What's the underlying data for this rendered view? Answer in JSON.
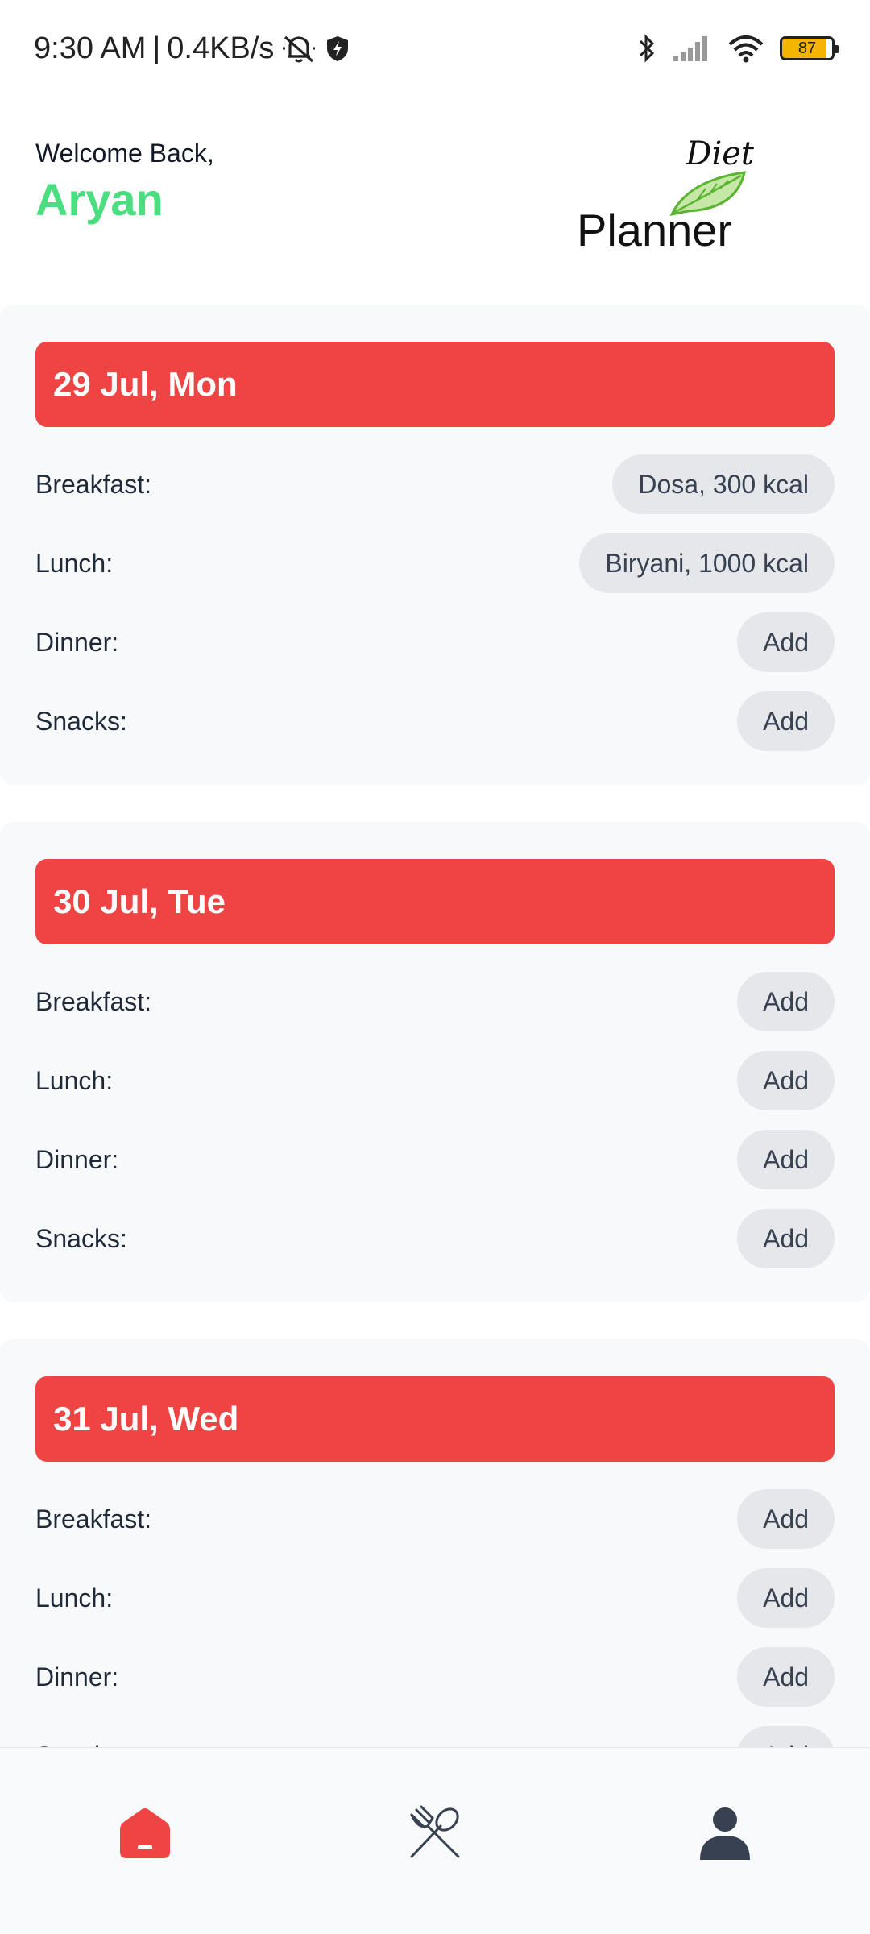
{
  "status_bar": {
    "time": "9:30 AM",
    "separator": "|",
    "network_speed": "0.4KB/s",
    "battery_level": "87",
    "icons": [
      "mute-bell-icon",
      "shield-icon",
      "bluetooth-icon",
      "signal-icon",
      "wifi-icon",
      "battery-icon"
    ]
  },
  "header": {
    "welcome_text": "Welcome Back,",
    "user_name": "Aryan",
    "logo_top": "Diet",
    "logo_bottom": "Planner"
  },
  "colors": {
    "accent_red": "#ef4444",
    "accent_green": "#4ade80",
    "pill_bg": "#e5e7eb",
    "card_bg": "#f8f9fb"
  },
  "days": [
    {
      "date": "29 Jul, Mon",
      "meals": [
        {
          "label": "Breakfast:",
          "value": "Dosa, 300 kcal"
        },
        {
          "label": "Lunch:",
          "value": "Biryani, 1000 kcal"
        },
        {
          "label": "Dinner:",
          "value": "Add"
        },
        {
          "label": "Snacks:",
          "value": "Add"
        }
      ]
    },
    {
      "date": "30 Jul, Tue",
      "meals": [
        {
          "label": "Breakfast:",
          "value": "Add"
        },
        {
          "label": "Lunch:",
          "value": "Add"
        },
        {
          "label": "Dinner:",
          "value": "Add"
        },
        {
          "label": "Snacks:",
          "value": "Add"
        }
      ]
    },
    {
      "date": "31 Jul, Wed",
      "meals": [
        {
          "label": "Breakfast:",
          "value": "Add"
        },
        {
          "label": "Lunch:",
          "value": "Add"
        },
        {
          "label": "Dinner:",
          "value": "Add"
        },
        {
          "label": "Snacks:",
          "value": "Add"
        }
      ]
    }
  ],
  "bottom_nav": [
    {
      "icon": "home-icon",
      "active": true
    },
    {
      "icon": "fork-spoon-icon",
      "active": false
    },
    {
      "icon": "profile-icon",
      "active": false
    }
  ]
}
